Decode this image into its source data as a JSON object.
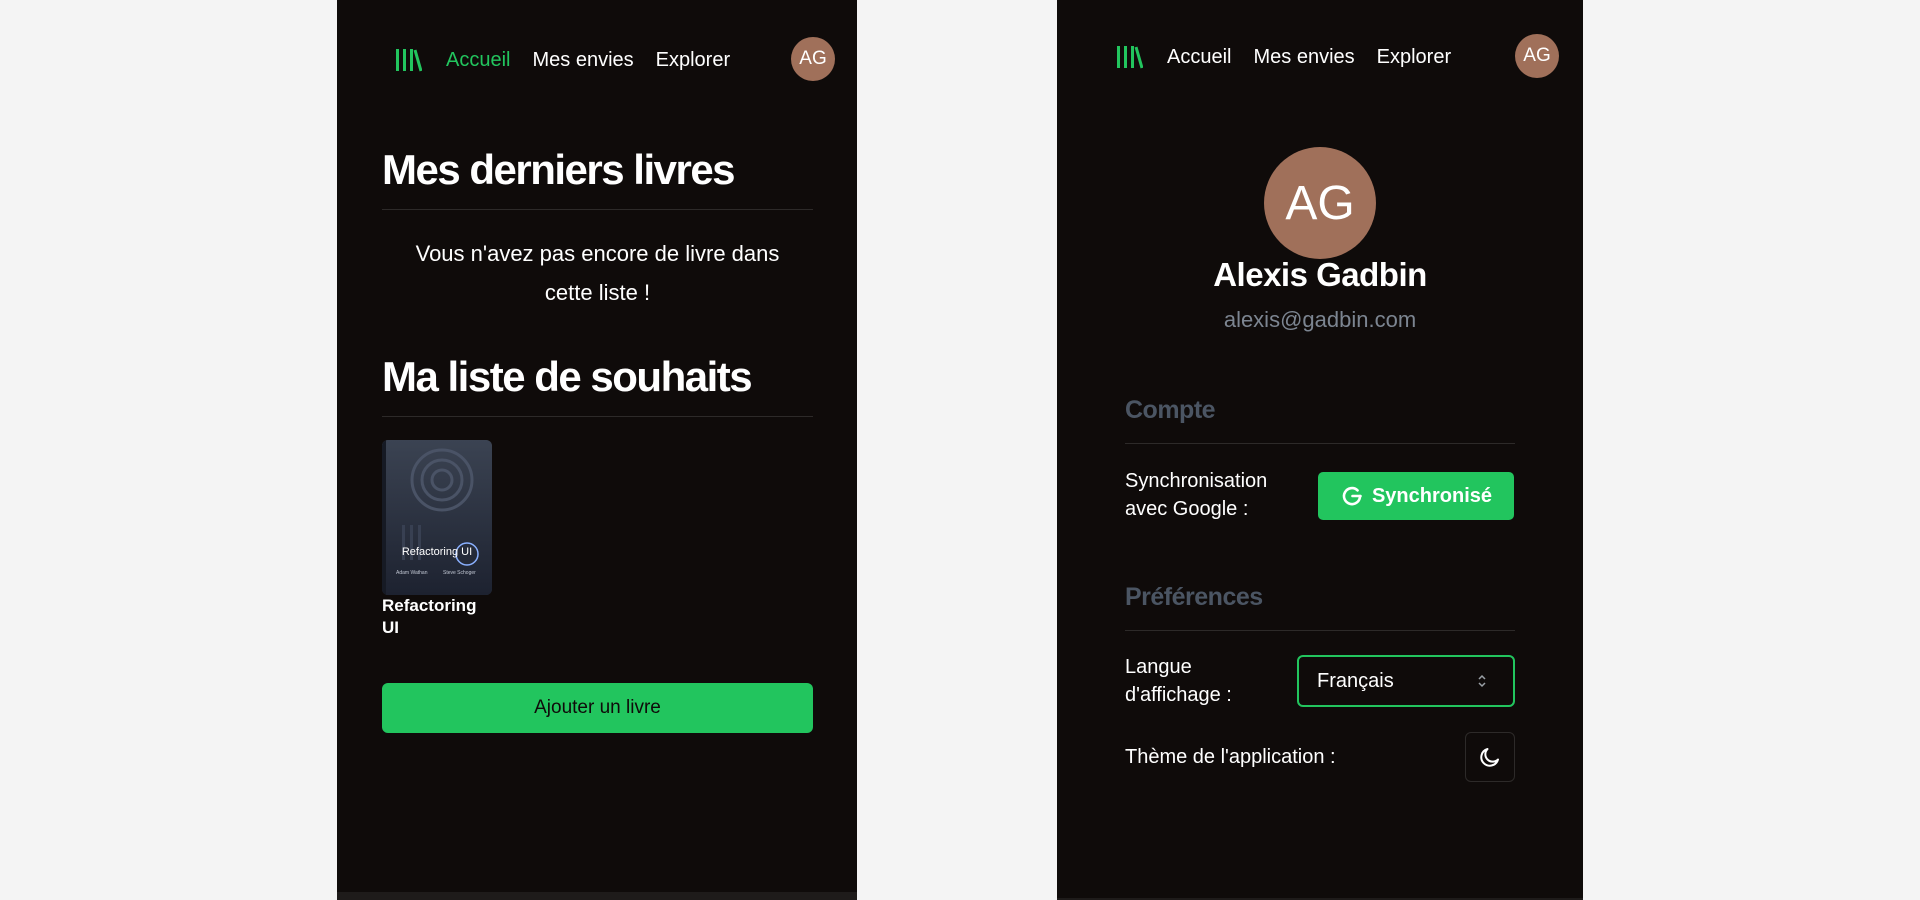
{
  "colors": {
    "accent": "#22c55e",
    "background": "#0f0b0a",
    "avatar": "#a0705a",
    "muted": "#4b5563"
  },
  "left_screen": {
    "nav": {
      "logo_icon": "library-icon",
      "links": [
        "Accueil",
        "Mes envies",
        "Explorer"
      ],
      "active_link": "Accueil",
      "avatar": "AG"
    },
    "latest_books": {
      "title": "Mes derniers livres",
      "empty_line1": "Vous n'avez pas encore de livre dans",
      "empty_line2": "cette liste !"
    },
    "wishlist": {
      "title": "Ma liste de souhaits",
      "books": [
        {
          "cover_title": "Refactoring UI",
          "cover_author_1": "Adam Wathan",
          "cover_author_2": "Steve Schoger",
          "title": "Refactoring UI"
        }
      ]
    },
    "add_button": "Ajouter un livre"
  },
  "right_screen": {
    "nav": {
      "logo_icon": "library-icon",
      "links": [
        "Accueil",
        "Mes envies",
        "Explorer"
      ],
      "avatar": "AG"
    },
    "profile": {
      "initials": "AG",
      "name": "Alexis Gadbin",
      "email": "alexis@gadbin.com"
    },
    "account": {
      "title": "Compte",
      "sync_label_line1": "Synchronisation",
      "sync_label_line2": "avec Google :",
      "sync_button": "Synchronisé",
      "sync_icon": "google-icon"
    },
    "preferences": {
      "title": "Préférences",
      "language_label_line1": "Langue",
      "language_label_line2": "d'affichage :",
      "language_value": "Français",
      "theme_label": "Thème de l'application :",
      "theme_icon": "moon-icon"
    }
  }
}
